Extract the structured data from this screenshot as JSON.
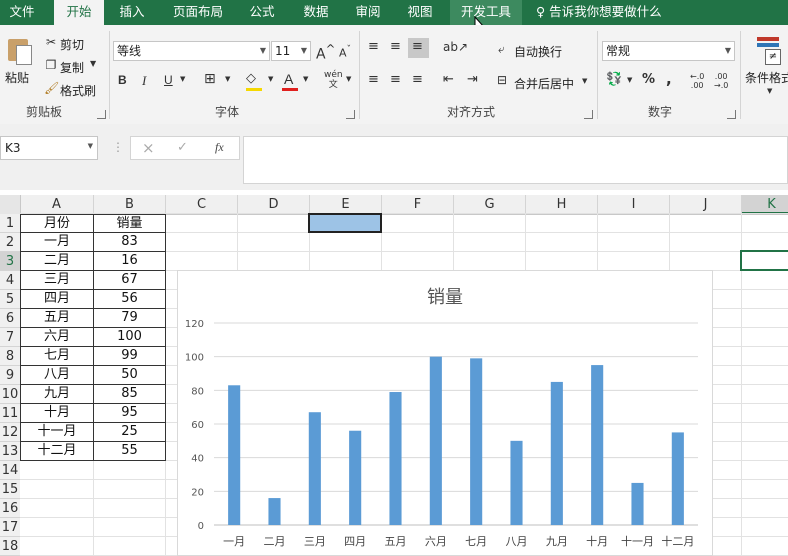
{
  "tabs": [
    {
      "label": "文件"
    },
    {
      "label": "开始"
    },
    {
      "label": "插入"
    },
    {
      "label": "页面布局"
    },
    {
      "label": "公式"
    },
    {
      "label": "数据"
    },
    {
      "label": "审阅"
    },
    {
      "label": "视图"
    },
    {
      "label": "开发工具"
    }
  ],
  "tell_me": "告诉我你想要做什么",
  "ribbon": {
    "clipboard": {
      "paste": "粘贴",
      "cut": "剪切",
      "copy": "复制",
      "format_painter": "格式刷",
      "group": "剪贴板"
    },
    "font": {
      "name": "等线",
      "size": "11",
      "bold": "B",
      "italic": "I",
      "underline": "U",
      "group": "字体",
      "grow": "A",
      "shrink": "A",
      "fontcolor": "A",
      "phonetic": "wén"
    },
    "alignment": {
      "wrap": "自动换行",
      "merge": "合并后居中",
      "group": "对齐方式"
    },
    "number": {
      "format": "常规",
      "percent": "%",
      "comma": ",",
      "group": "数字"
    },
    "styles": {
      "conditional": "条件格式"
    }
  },
  "namebox": "K3",
  "formula_icons": {
    "cancel": "×",
    "enter": "✓",
    "fx": "fx"
  },
  "columns": [
    "A",
    "B",
    "C",
    "D",
    "E",
    "F",
    "G",
    "H",
    "I",
    "J",
    "K"
  ],
  "rows": [
    "1",
    "2",
    "3",
    "4",
    "5",
    "6",
    "7",
    "8",
    "9",
    "10",
    "11",
    "12",
    "13",
    "14",
    "15",
    "16",
    "17",
    "18"
  ],
  "table": {
    "header": [
      "月份",
      "销量"
    ],
    "rows": [
      [
        "一月",
        "83"
      ],
      [
        "二月",
        "16"
      ],
      [
        "三月",
        "67"
      ],
      [
        "四月",
        "56"
      ],
      [
        "五月",
        "79"
      ],
      [
        "六月",
        "100"
      ],
      [
        "七月",
        "99"
      ],
      [
        "八月",
        "50"
      ],
      [
        "九月",
        "85"
      ],
      [
        "十月",
        "95"
      ],
      [
        "十一月",
        "25"
      ],
      [
        "十二月",
        "55"
      ]
    ]
  },
  "colors": {
    "accent": "#217346",
    "bar": "#5b9bd5"
  },
  "chart_data": {
    "type": "bar",
    "title": "销量",
    "categories": [
      "一月",
      "二月",
      "三月",
      "四月",
      "五月",
      "六月",
      "七月",
      "八月",
      "九月",
      "十月",
      "十一月",
      "十二月"
    ],
    "values": [
      83,
      16,
      67,
      56,
      79,
      100,
      99,
      50,
      85,
      95,
      25,
      55
    ],
    "yticks": [
      "0",
      "20",
      "40",
      "60",
      "80",
      "100",
      "120"
    ],
    "ylim": [
      0,
      120
    ],
    "grid": true
  }
}
